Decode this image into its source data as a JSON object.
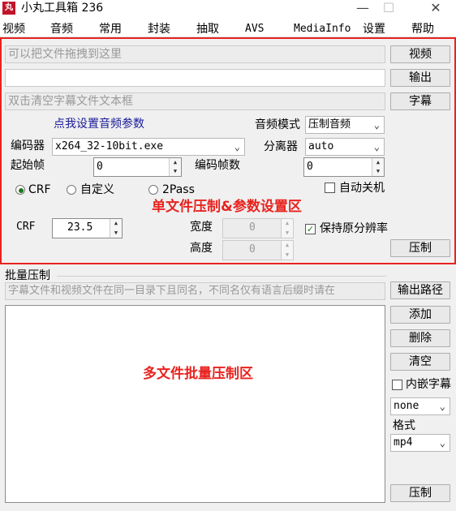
{
  "window": {
    "icon_text": "丸",
    "title": "小丸工具箱 236",
    "minimize": "—",
    "maximize": "☐",
    "close": "✕"
  },
  "menu": [
    "视频",
    "音频",
    "常用",
    "封装",
    "抽取",
    "AVS",
    "MediaInfo",
    "设置",
    "帮助"
  ],
  "single": {
    "video_placeholder": "可以把文件拖拽到这里",
    "video_btn": "视频",
    "output_btn": "输出",
    "subtitle_placeholder": "双击清空字幕文件文本框",
    "subtitle_btn": "字幕",
    "audio_link": "点我设置音频参数",
    "audio_mode_label": "音频模式",
    "audio_mode_value": "压制音频",
    "encoder_label": "编码器",
    "encoder_value": "x264_32-10bit.exe",
    "splitter_label": "分离器",
    "splitter_value": "auto",
    "start_frame_label": "起始帧",
    "start_frame_value": "0",
    "encode_frames_label": "编码帧数",
    "encode_frames_value": "0",
    "mode_crf": "CRF",
    "mode_custom": "自定义",
    "mode_2pass": "2Pass",
    "auto_shutdown": "自动关机",
    "annotation": "单文件压制&参数设置区",
    "crf_label": "CRF",
    "crf_value": "23.5",
    "width_label": "宽度",
    "width_value": "0",
    "height_label": "高度",
    "height_value": "0",
    "keep_res": "保持原分辨率",
    "compress_btn": "压制"
  },
  "batch": {
    "group_label": "批量压制",
    "hint": "字幕文件和视频文件在同一目录下且同名，不同名仅有语言后缀时请在",
    "output_path_btn": "输出路径",
    "add_btn": "添加",
    "delete_btn": "删除",
    "clear_btn": "清空",
    "embed_sub": "内嵌字幕",
    "sub_select": "none",
    "format_label": "格式",
    "format_value": "mp4",
    "annotation": "多文件批量压制区",
    "compress_btn": "压制"
  },
  "colors": {
    "annotation_red": "#e8231f",
    "check_green": "#1a7a1a"
  }
}
